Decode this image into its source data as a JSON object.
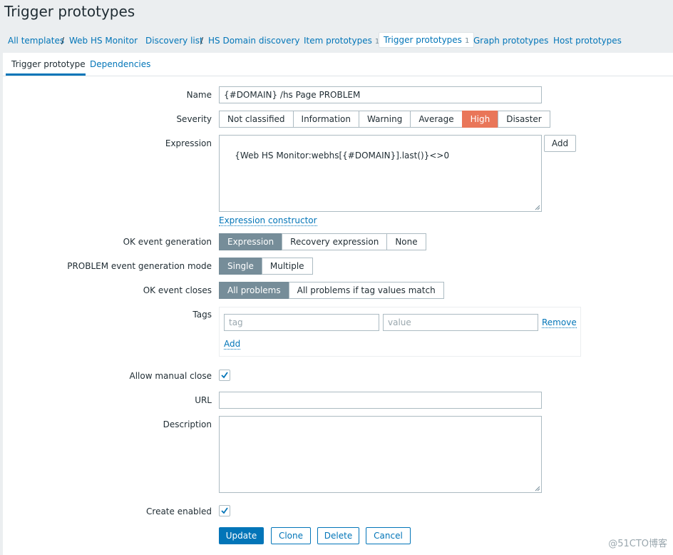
{
  "page": {
    "title": "Trigger prototypes"
  },
  "breadcrumbs": {
    "all_templates": "All templates",
    "template": "Web HS Monitor",
    "discovery_list": "Discovery list",
    "discovery_rule": "HS Domain discovery",
    "item_prototypes": "Item prototypes",
    "item_prototypes_count": "1",
    "trigger_prototypes": "Trigger prototypes",
    "trigger_prototypes_count": "1",
    "graph_prototypes": "Graph prototypes",
    "host_prototypes": "Host prototypes",
    "separator": "/"
  },
  "tabs": {
    "trigger_prototype": "Trigger prototype",
    "dependencies": "Dependencies"
  },
  "form": {
    "name_label": "Name",
    "name_value": "{#DOMAIN} /hs Page PROBLEM",
    "severity_label": "Severity",
    "severity_options": [
      "Not classified",
      "Information",
      "Warning",
      "Average",
      "High",
      "Disaster"
    ],
    "severity_selected": "High",
    "expression_label": "Expression",
    "expression_value": "{Web HS Monitor:webhs[{#DOMAIN}].last()}<>0",
    "expression_add": "Add",
    "expression_constructor": "Expression constructor",
    "ok_event_generation_label": "OK event generation",
    "ok_event_generation_options": [
      "Expression",
      "Recovery expression",
      "None"
    ],
    "ok_event_generation_selected": "Expression",
    "problem_mode_label": "PROBLEM event generation mode",
    "problem_mode_options": [
      "Single",
      "Multiple"
    ],
    "problem_mode_selected": "Single",
    "ok_event_closes_label": "OK event closes",
    "ok_event_closes_options": [
      "All problems",
      "All problems if tag values match"
    ],
    "ok_event_closes_selected": "All problems",
    "tags_label": "Tags",
    "tag_placeholder": "tag",
    "value_placeholder": "value",
    "tag_remove": "Remove",
    "tag_add": "Add",
    "allow_manual_close_label": "Allow manual close",
    "allow_manual_close_checked": true,
    "url_label": "URL",
    "url_value": "",
    "description_label": "Description",
    "description_value": "",
    "create_enabled_label": "Create enabled",
    "create_enabled_checked": true,
    "buttons": {
      "update": "Update",
      "clone": "Clone",
      "delete": "Delete",
      "cancel": "Cancel"
    }
  },
  "watermark": "@51CTO博客",
  "colors": {
    "link": "#0275b8",
    "selected_segment": "#768d99",
    "severity_high": "#e97659",
    "page_bg": "#ebeef0"
  }
}
